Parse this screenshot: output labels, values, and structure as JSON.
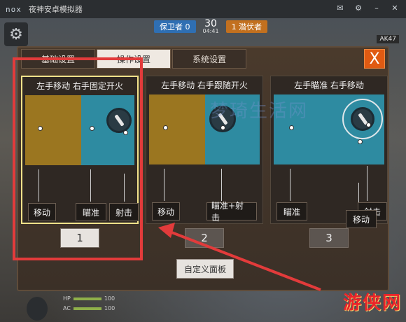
{
  "emulator": {
    "logo": "nox",
    "title": "夜神安卓模拟器"
  },
  "hud": {
    "team_defender": "保卫者 0",
    "score": "30",
    "time": "04:41",
    "team_invader": "1 潜伏者",
    "weapon": "AK47",
    "hp_label": "HP",
    "hp_value": "100",
    "ac_label": "AC",
    "ac_value": "100"
  },
  "dialog": {
    "tabs": [
      {
        "label": "基础设置",
        "active": false
      },
      {
        "label": "操作设置",
        "active": true
      },
      {
        "label": "系统设置",
        "active": false
      }
    ],
    "close_label": "X",
    "layouts": [
      {
        "title": "左手移动 右手固定开火",
        "labels": [
          "移动",
          "瞄准",
          "射击"
        ],
        "button": "1",
        "selected": true
      },
      {
        "title": "左手移动 右手跟随开火",
        "labels": [
          "移动",
          "瞄准+射击"
        ],
        "button": "2",
        "selected": false
      },
      {
        "title": "左手瞄准 右手移动",
        "labels": [
          "瞄准",
          "射击",
          "移动"
        ],
        "button": "3",
        "selected": false
      }
    ],
    "custom_button": "自定义面板"
  },
  "overlay": {
    "watermark": "梦琦生活网",
    "corner_logo": "游侠网"
  },
  "colors": {
    "accent_orange": "#e05a12",
    "highlight_red": "#e23b3b",
    "zone_gold": "#9b7620",
    "zone_teal": "#2e8ba1"
  }
}
